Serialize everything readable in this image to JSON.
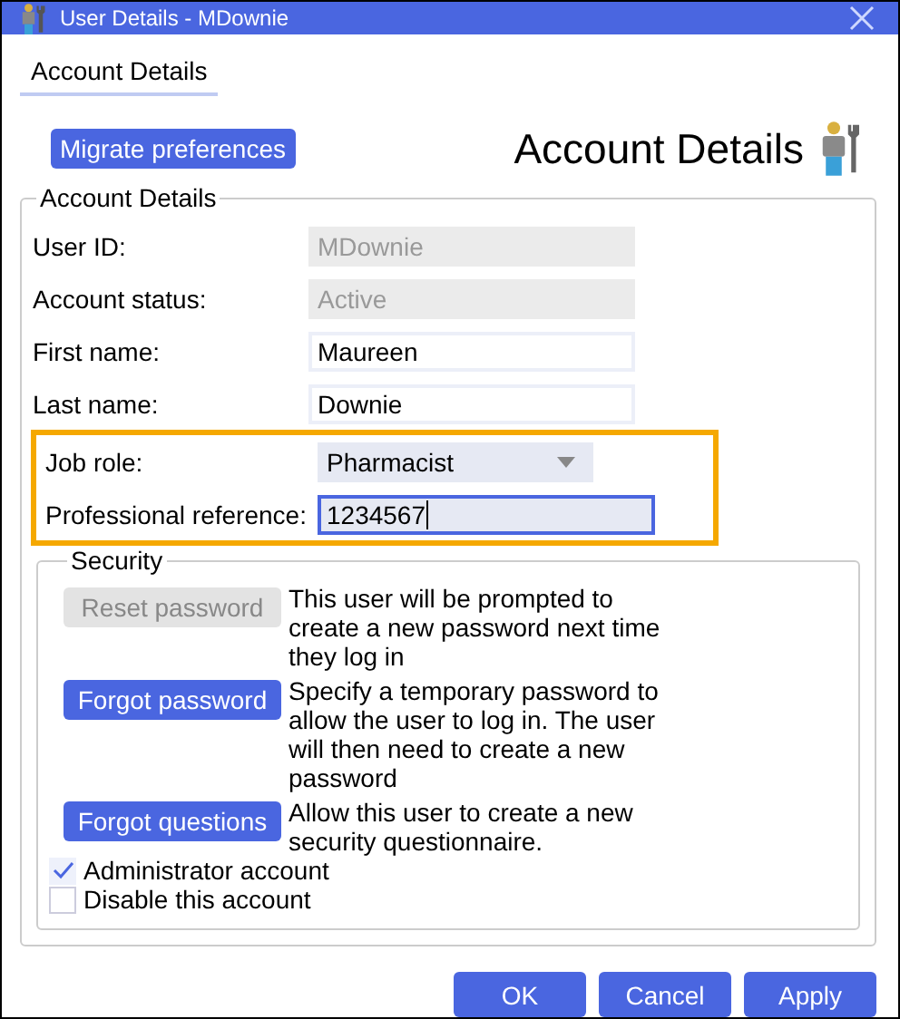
{
  "window": {
    "title": "User Details - MDownie"
  },
  "tabs": [
    {
      "label": "Account Details",
      "selected": true
    }
  ],
  "migrate_button": "Migrate preferences",
  "heading": "Account Details",
  "account_group": {
    "title": "Account Details",
    "fields": [
      {
        "label": "User ID:",
        "kind": "text",
        "value": "MDownie",
        "disabled": true,
        "focused": false,
        "highlighted": false
      },
      {
        "label": "Account status:",
        "kind": "text",
        "value": "Active",
        "disabled": true,
        "focused": false,
        "highlighted": false
      },
      {
        "label": "First name:",
        "kind": "text",
        "value": "Maureen",
        "disabled": false,
        "focused": false,
        "highlighted": false
      },
      {
        "label": "Last name:",
        "kind": "text",
        "value": "Downie",
        "disabled": false,
        "focused": false,
        "highlighted": false
      },
      {
        "label": "Job role:",
        "kind": "dropdown",
        "value": "Pharmacist",
        "disabled": false,
        "focused": false,
        "highlighted": true
      },
      {
        "label": "Professional reference:",
        "kind": "text",
        "value": "1234567",
        "disabled": false,
        "focused": true,
        "highlighted": true
      }
    ]
  },
  "security_group": {
    "title": "Security",
    "actions": [
      {
        "button": "Reset password",
        "disabled": true,
        "description": "This user will be prompted to create a new password next time they log in"
      },
      {
        "button": "Forgot password",
        "disabled": false,
        "description": "Specify a temporary password to allow the user to log in. The user will then need to create a new password"
      },
      {
        "button": "Forgot questions",
        "disabled": false,
        "description": "Allow this user to create a new security questionnaire."
      }
    ],
    "checkboxes": [
      {
        "label": "Administrator account",
        "checked": true
      },
      {
        "label": "Disable this account",
        "checked": false
      }
    ]
  },
  "buttons": [
    "OK",
    "Cancel",
    "Apply"
  ]
}
